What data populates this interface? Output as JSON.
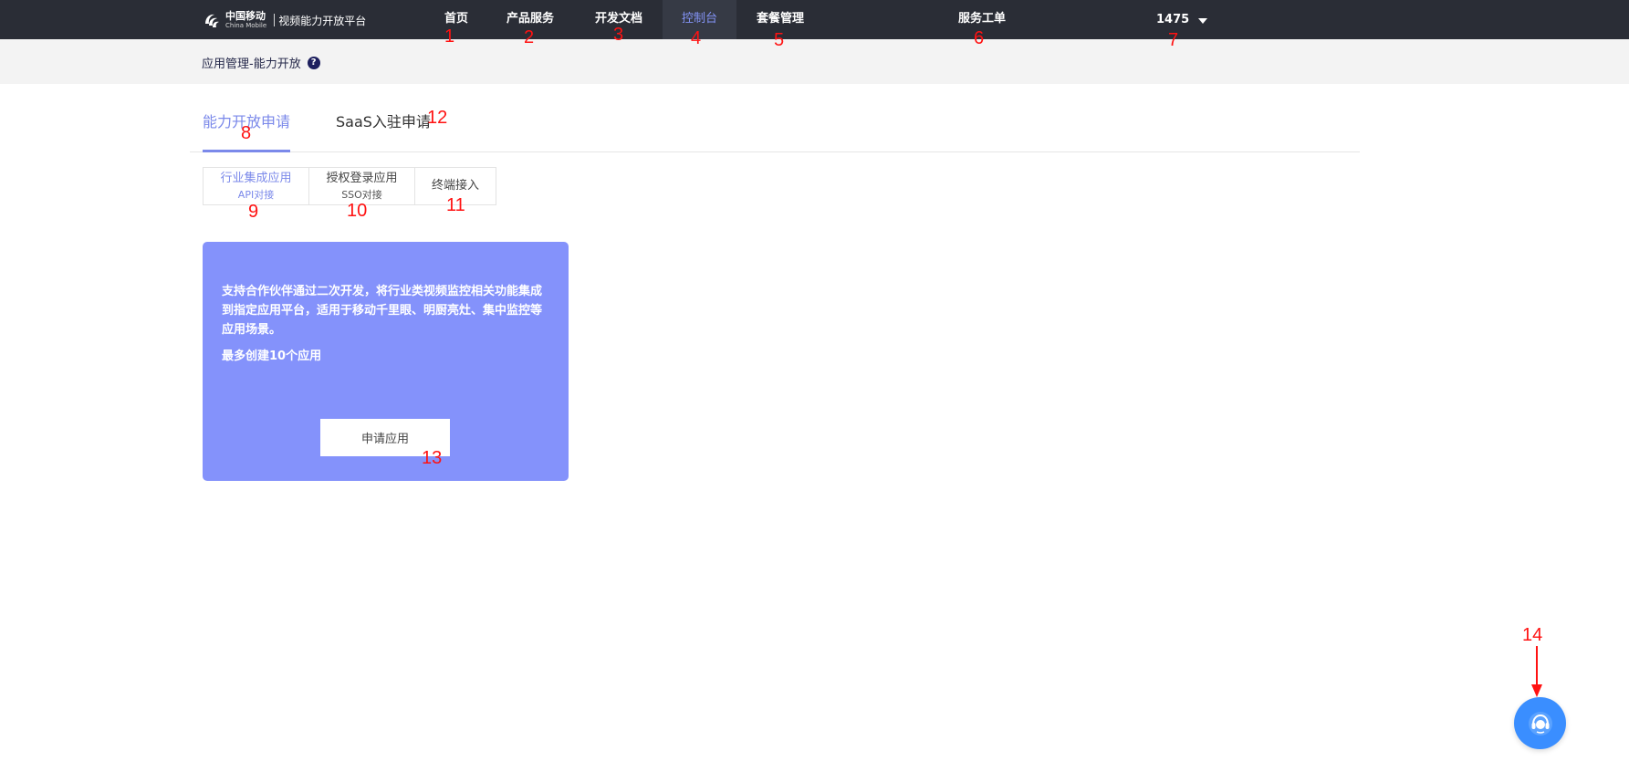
{
  "brand": {
    "company_cn": "中国移动",
    "company_en": "China Mobile",
    "platform": "视频能力开放平台"
  },
  "nav": {
    "items": [
      {
        "label": "首页"
      },
      {
        "label": "产品服务"
      },
      {
        "label": "开发文档"
      },
      {
        "label": "控制台",
        "active": true
      },
      {
        "label": "套餐管理"
      },
      {
        "label": "服务工单"
      }
    ],
    "user": "1475"
  },
  "breadcrumb": {
    "text": "应用管理-能力开放",
    "help": "?"
  },
  "main_tabs": [
    {
      "label": "能力开放申请",
      "active": true
    },
    {
      "label": "SaaS入驻申请"
    }
  ],
  "sub_tabs": [
    {
      "title": "行业集成应用",
      "sub": "API对接",
      "active": true
    },
    {
      "title": "授权登录应用",
      "sub": "SSO对接"
    },
    {
      "title": "终端接入",
      "sub": ""
    }
  ],
  "card": {
    "description": "支持合作伙伴通过二次开发，将行业类视频监控相关功能集成到指定应用平台，适用于移动千里眼、明厨亮灶、集中监控等应用场景。",
    "limit": "最多创建10个应用",
    "button": "申请应用"
  },
  "annotations": [
    "1",
    "2",
    "3",
    "4",
    "5",
    "6",
    "7",
    "8",
    "9",
    "10",
    "11",
    "12",
    "13",
    "14"
  ],
  "colors": {
    "topbar": "#2a2d36",
    "accent": "#7b89ea",
    "card": "#8492fb",
    "annotation": "#ff1212",
    "fab": "#3a8eff"
  }
}
